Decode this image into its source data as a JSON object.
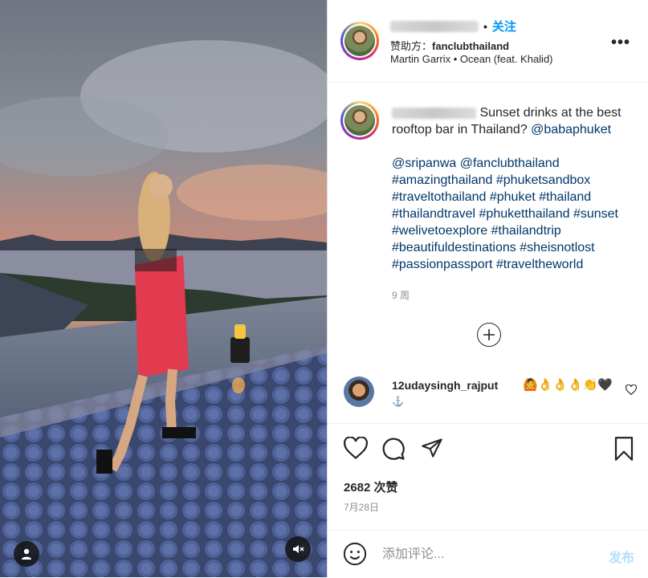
{
  "media": {
    "icons": {
      "user_tag": "person-icon",
      "mute": "speaker-muted-icon"
    }
  },
  "header": {
    "follow_label": "关注",
    "sponsor_prefix": "赞助方：",
    "sponsor_name": "fanclubthailand",
    "music": "Martin Garrix • Ocean (feat. Khalid)",
    "more_label": "•••"
  },
  "caption": {
    "text_before": " Sunset drinks at the best rooftop bar in Thailand? ",
    "mention_baba": "@babaphuket",
    "tags": "@sripanwa @fanclubthailand #amazingthailand #phuketsandbox #traveltothailand #phuket #thailand #thailandtravel #phuketthailand #sunset #welivetoexplore #thailandtrip #beautifuldestinations #sheisnotlost #passionpassport #traveltheworld",
    "time": "9 周"
  },
  "comment": {
    "username": "12udaysingh_rajput",
    "emojis": "🙆👌👌👌👏🖤",
    "anchor": "⚓"
  },
  "stats": {
    "views": "2682 次赞",
    "date": "7月28日"
  },
  "composer": {
    "placeholder": "添加评论...",
    "post_label": "发布",
    "emoji_icon": "smiley-icon"
  },
  "colors": {
    "accent": "#0095f6",
    "link": "#00376b",
    "post_disabled": "#b2dffc"
  }
}
